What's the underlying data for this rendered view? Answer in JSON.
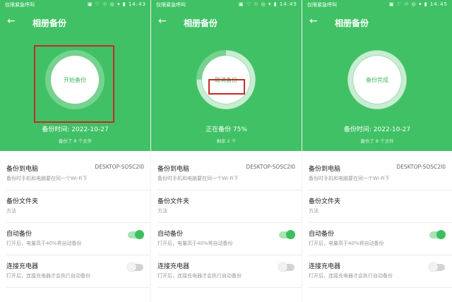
{
  "status_bar": {
    "carrier": "仅限紧急呼叫",
    "icons": "▣ ♡ ☉ ◎ ▾ ▮"
  },
  "colors": {
    "accent": "#40c165",
    "button_text": "#45b85c",
    "highlight": "#c22d2a"
  },
  "screens": [
    {
      "title": "相册备份",
      "time": "14:43",
      "circle_label": "开始备份",
      "progress": 0,
      "status_line": "备份时间: 2022-10-27",
      "sub_line": "备份了 8 个文件",
      "settings": {
        "backup_to_pc": {
          "label": "备份到电脑",
          "value": "DESKTOP-SOSC2I0",
          "desc": "备份时手机和电脑要在同一个Wi-Fi下"
        },
        "backup_folder": {
          "label": "备份文件夹",
          "desc": "方法"
        },
        "auto_backup": {
          "label": "自动备份",
          "desc": "打开后，电量高于40%将自动备份",
          "on": true
        },
        "charger": {
          "label": "连接充电器",
          "desc": "打开后，连接充电器才会执行自动备份",
          "on": false
        }
      }
    },
    {
      "title": "相册备份",
      "time": "14:45",
      "circle_label": "取消备份",
      "progress": 0.75,
      "status_line": "正在备份 75%",
      "sub_line": "剩余 2 个",
      "settings": {
        "backup_to_pc": {
          "label": "备份到电脑",
          "value": "DESKTOP-SOSC2I0",
          "desc": "备份时手机和电脑要在同一个Wi-Fi下"
        },
        "backup_folder": {
          "label": "备份文件夹",
          "desc": "方法"
        },
        "auto_backup": {
          "label": "自动备份",
          "desc": "打开后，电量高于40%将自动备份",
          "on": true
        },
        "charger": {
          "label": "连接充电器",
          "desc": "打开后，连接充电器才会执行自动备份",
          "on": false
        }
      }
    },
    {
      "title": "相册备份",
      "time": "14:45",
      "circle_label": "备份完成",
      "progress": 1,
      "status_line": "备份时间: 2022-10-27",
      "sub_line": "备份了 8 个文件",
      "settings": {
        "backup_to_pc": {
          "label": "备份到电脑",
          "value": "DESKTOP-SOSC2I0",
          "desc": "备份时手机和电脑要在同一个Wi-Fi下"
        },
        "backup_folder": {
          "label": "备份文件夹",
          "desc": "方法"
        },
        "auto_backup": {
          "label": "自动备份",
          "desc": "打开后，电量高于40%将自动备份",
          "on": true
        },
        "charger": {
          "label": "连接充电器",
          "desc": "打开后，连接充电器才会执行自动备份",
          "on": false
        }
      }
    }
  ]
}
